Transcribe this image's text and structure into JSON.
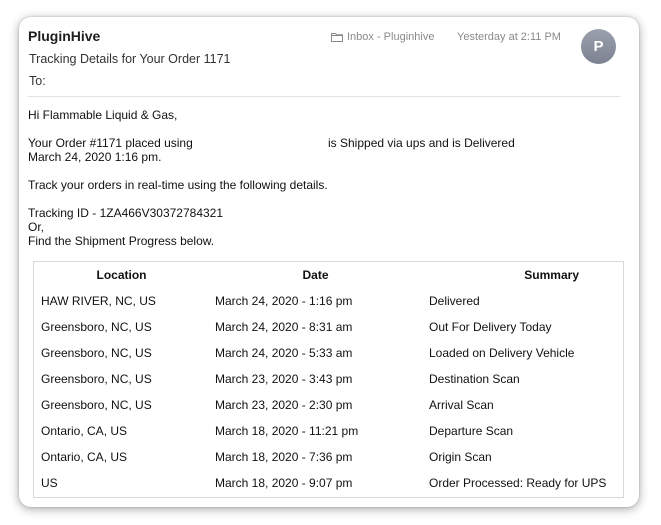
{
  "header": {
    "sender": "PluginHive",
    "subject": "Tracking Details for Your Order 1171",
    "to_label": "To:",
    "mailbox": "Inbox - Pluginhive",
    "mailbox_icon": "folder-icon",
    "timestamp": "Yesterday at 2:11 PM",
    "avatar_initial": "P"
  },
  "body": {
    "greeting": "Hi Flammable Liquid & Gas,",
    "order_line_start": "Your Order #1171 placed using",
    "order_line_end": "is Shipped via ups and is Delivered",
    "order_date": "March 24, 2020 1:16 pm.",
    "track_line": "Track your orders in real-time using the following details.",
    "tracking_id": "Tracking ID - 1ZA466V30372784321",
    "or_line": "Or,",
    "progress_line": "Find the Shipment Progress below."
  },
  "table": {
    "headers": [
      "Location",
      "Date",
      "Summary"
    ],
    "rows": [
      [
        "HAW RIVER, NC, US",
        "March 24, 2020 - 1:16 pm",
        "Delivered"
      ],
      [
        "Greensboro, NC, US",
        "March 24, 2020 - 8:31 am",
        "Out For Delivery Today"
      ],
      [
        "Greensboro, NC, US",
        "March 24, 2020 - 5:33 am",
        "Loaded on Delivery Vehicle"
      ],
      [
        "Greensboro, NC, US",
        "March 23, 2020 - 3:43 pm",
        "Destination Scan"
      ],
      [
        "Greensboro, NC, US",
        "March 23, 2020 - 2:30 pm",
        "Arrival Scan"
      ],
      [
        "Ontario, CA, US",
        "March 18, 2020 - 11:21 pm",
        "Departure Scan"
      ],
      [
        "Ontario, CA, US",
        "March 18, 2020 - 7:36 pm",
        "Origin Scan"
      ],
      [
        "US",
        "March 18, 2020 - 9:07 pm",
        "Order Processed: Ready for UPS"
      ]
    ]
  }
}
